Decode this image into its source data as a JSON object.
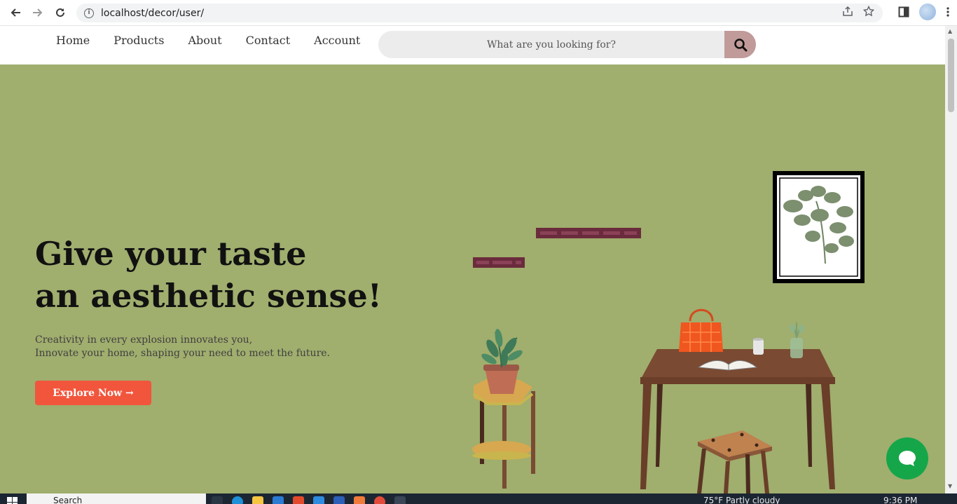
{
  "browser": {
    "url": "localhost/decor/user/",
    "icons": {
      "back": "arrow-left-icon",
      "forward": "arrow-right-icon",
      "reload": "reload-icon",
      "site_info": "info-icon",
      "share": "share-icon",
      "bookmark": "star-icon",
      "side_panel": "side-panel-icon",
      "menu": "kebab-menu-icon"
    }
  },
  "header": {
    "nav": [
      {
        "label": "Home"
      },
      {
        "label": "Products"
      },
      {
        "label": "About"
      },
      {
        "label": "Contact"
      },
      {
        "label": "Account"
      }
    ],
    "search": {
      "placeholder": "What are you looking for?",
      "button_icon": "search-icon"
    }
  },
  "hero": {
    "title_line1": "Give your taste",
    "title_line2": "an aesthetic sense!",
    "subtitle_line1": "Creativity in every explosion innovates you,",
    "subtitle_line2": "Innovate your home, shaping your need to meet the future.",
    "cta_label": "Explore Now →"
  },
  "chat": {
    "icon": "chat-bubble-icon"
  },
  "taskbar": {
    "search_label": "Search",
    "weather": "75°F  Partly cloudy",
    "time": "9:36 PM"
  },
  "colors": {
    "hero_bg": "#a0ae6e",
    "cta": "#f1553c",
    "search_button": "#c19a9a",
    "chat_button": "#16a64a"
  }
}
